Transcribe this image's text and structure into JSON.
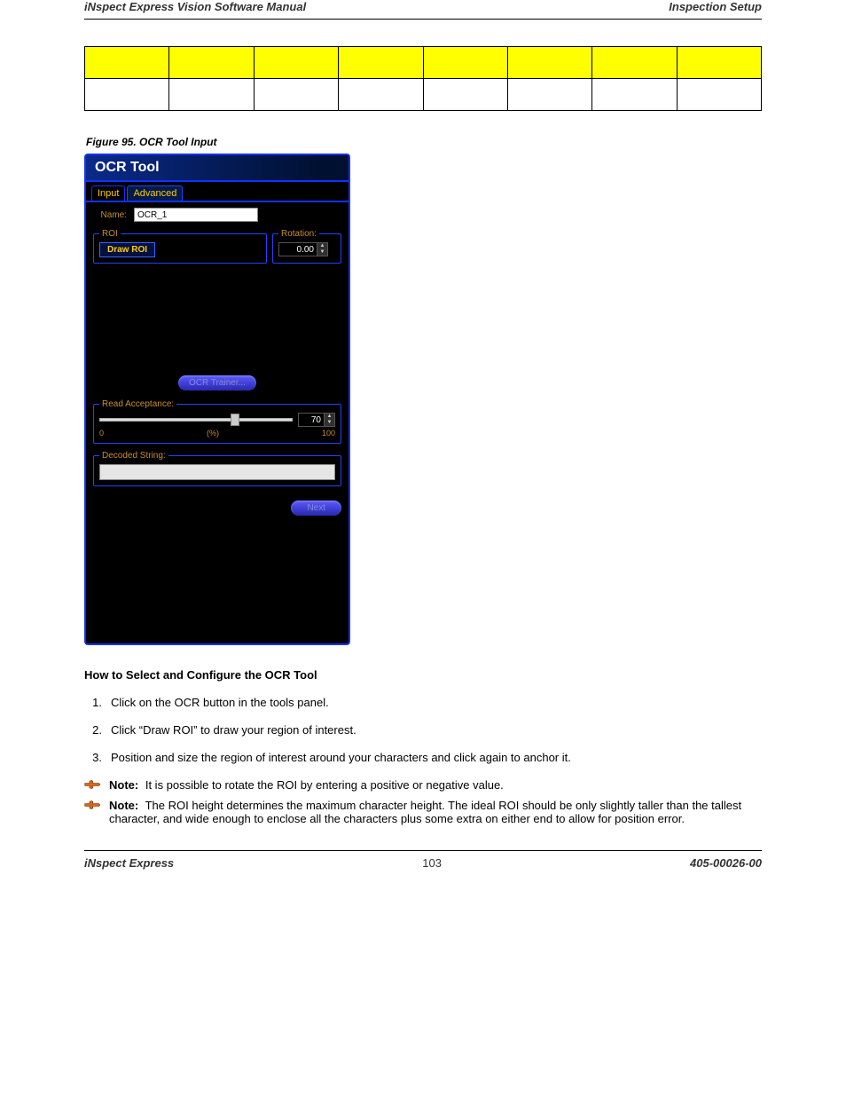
{
  "header": {
    "left": "iNspect Express Vision Software Manual",
    "right": "Inspection Setup"
  },
  "chart_data": {
    "type": "table",
    "columns": 8,
    "rows": 2,
    "header_row_blank": true,
    "data_row_blank": true
  },
  "figure_caption": "Figure 95. OCR Tool Input",
  "ocr_panel": {
    "title": "OCR Tool",
    "tabs": {
      "input": "Input",
      "advanced": "Advanced"
    },
    "name_label": "Name:",
    "name_value": "OCR_1",
    "roi_legend": "ROI",
    "draw_roi_label": "Draw ROI",
    "rotation_legend": "Rotation:",
    "rotation_value": "0.00",
    "trainer_label": "OCR Trainer...",
    "accept_legend": "Read Acceptance:",
    "accept_value": "70",
    "scale_min": "0",
    "scale_unit": "(%)",
    "scale_max": "100",
    "decoded_legend": "Decoded String:",
    "decoded_value": "",
    "next_label": "Next"
  },
  "howto": {
    "heading": "How to Select and Configure the OCR Tool",
    "steps": [
      "Click on the OCR button in the tools panel.",
      "Click “Draw ROI” to draw your region of interest.",
      "Position and size the region of interest around your characters and click again to anchor it."
    ],
    "notes": [
      "It is possible to rotate the ROI by entering a positive or negative value.",
      "The ROI height determines the maximum character height. The ideal ROI should be only slightly taller than the tallest character, and wide enough to enclose all the characters plus some extra on either end to allow for position error."
    ],
    "note_label": "Note:"
  },
  "footer": {
    "left": "iNspect Express",
    "center": "103",
    "right": "405-00026-00"
  }
}
